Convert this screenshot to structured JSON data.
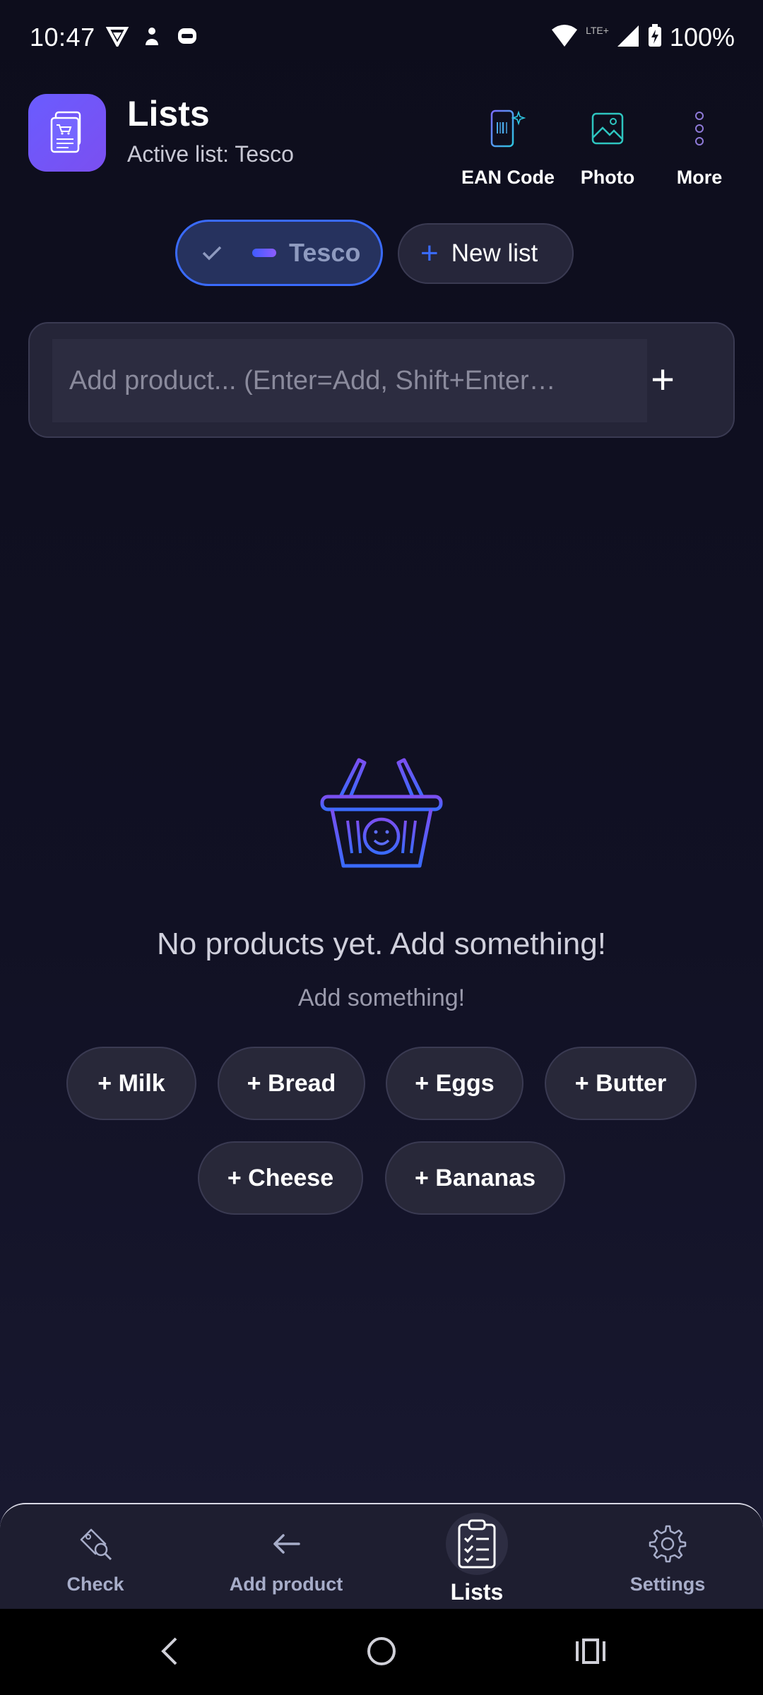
{
  "status_bar": {
    "time": "10:47",
    "network": "LTE+",
    "battery": "100%",
    "left_icons": [
      "vpn-icon",
      "pet-icon",
      "wear-icon"
    ]
  },
  "header": {
    "title": "Lists",
    "subtitle": "Active list: Tesco",
    "tools": [
      {
        "label": "EAN Code",
        "icon": "barcode-phone-icon"
      },
      {
        "label": "Photo",
        "icon": "image-icon"
      },
      {
        "label": "More",
        "icon": "more-vertical-icon"
      }
    ]
  },
  "lists": {
    "active": "Tesco",
    "new_label": "New list"
  },
  "add_product": {
    "placeholder": "Add product... (Enter=Add, Shift+Enter…",
    "value": ""
  },
  "empty_state": {
    "title": "No products yet. Add something!",
    "subtitle": "Add something!",
    "suggestions": [
      "+ Milk",
      "+ Bread",
      "+ Eggs",
      "+ Butter",
      "+ Cheese",
      "+ Bananas"
    ]
  },
  "bottom_nav": {
    "items": [
      {
        "label": "Check",
        "icon": "price-tag-search-icon"
      },
      {
        "label": "Add product",
        "icon": "arrow-left-icon"
      },
      {
        "label": "Lists",
        "icon": "clipboard-list-icon"
      },
      {
        "label": "Settings",
        "icon": "gear-icon"
      }
    ],
    "active": "Lists"
  },
  "colors": {
    "accent": "#3a6bff",
    "logo_start": "#6a5cff",
    "logo_end": "#7b4ff0",
    "background": "#0f0f1e"
  }
}
